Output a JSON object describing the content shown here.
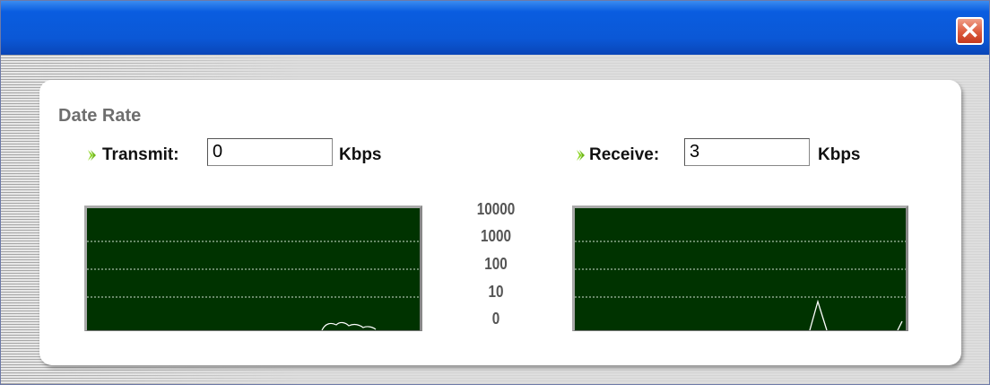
{
  "window": {
    "close_symbol": "✕"
  },
  "panel": {
    "title": "Date Rate"
  },
  "transmit": {
    "label": "Transmit:",
    "value": "0",
    "unit": "Kbps"
  },
  "receive": {
    "label": "Receive:",
    "value": "3",
    "unit": "Kbps"
  },
  "scale": {
    "labels": [
      "10000",
      "1000",
      "100",
      "10",
      "0"
    ]
  },
  "icons": {
    "arrow": "green-arrow-icon"
  },
  "colors": {
    "graph_bg": "#003300",
    "grid": "#cfe0cf",
    "trace": "#ffffff",
    "arrow": "#8fd62a",
    "title_bar": "#0a5de0",
    "close": "#dc5a3c"
  }
}
